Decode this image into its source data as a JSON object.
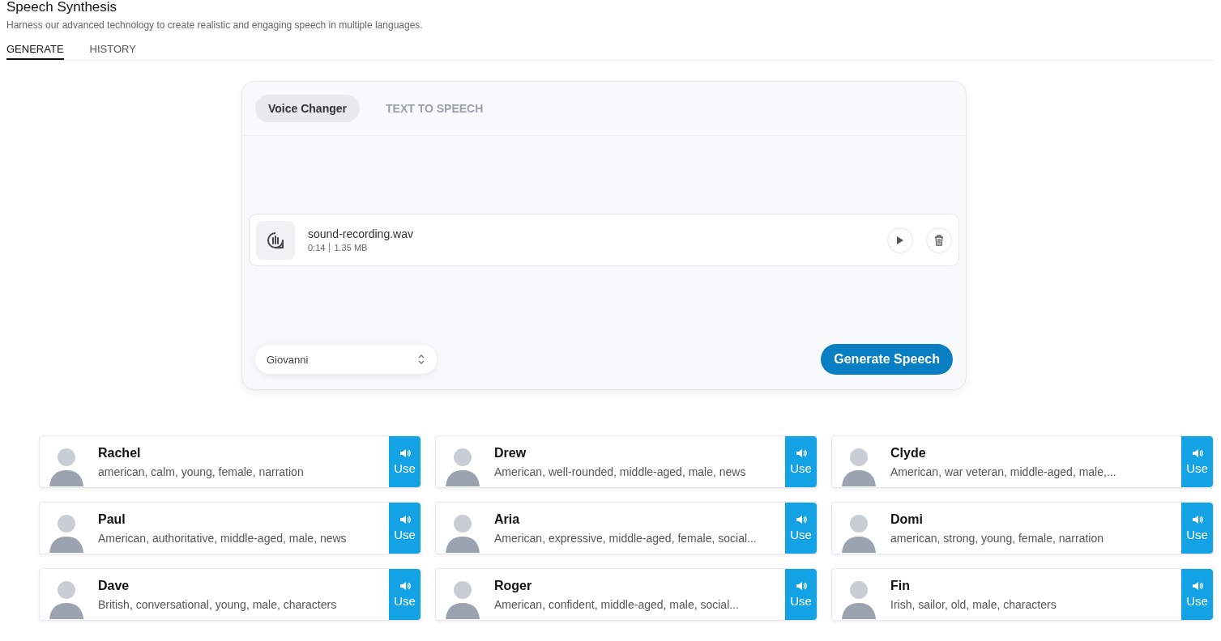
{
  "header": {
    "title": "Speech Synthesis",
    "subtitle": "Harness our advanced technology to create realistic and engaging speech in multiple languages."
  },
  "tabs": [
    {
      "label": "GENERATE",
      "selected": true
    },
    {
      "label": "HISTORY",
      "selected": false
    }
  ],
  "panel": {
    "tabs": [
      {
        "label": "Voice Changer",
        "selected": true
      },
      {
        "label": "TEXT TO SPEECH",
        "selected": false
      }
    ],
    "file": {
      "name": "sound-recording.wav",
      "duration": "0:14",
      "size": "1.35 MB"
    },
    "voice_select": {
      "value": "Giovanni"
    },
    "generate_button": "Generate Speech"
  },
  "voices": [
    {
      "name": "Rachel",
      "description": "american, calm, young, female, narration",
      "button": "Use"
    },
    {
      "name": "Drew",
      "description": "American, well-rounded, middle-aged, male, news",
      "button": "Use"
    },
    {
      "name": "Clyde",
      "description": "American, war veteran, middle-aged, male,...",
      "button": "Use"
    },
    {
      "name": "Paul",
      "description": "American, authoritative, middle-aged, male, news",
      "button": "Use"
    },
    {
      "name": "Aria",
      "description": "American, expressive, middle-aged, female, social...",
      "button": "Use"
    },
    {
      "name": "Domi",
      "description": "american, strong, young, female, narration",
      "button": "Use"
    },
    {
      "name": "Dave",
      "description": "British, conversational, young, male, characters",
      "button": "Use"
    },
    {
      "name": "Roger",
      "description": "American, confident, middle-aged, male, social...",
      "button": "Use"
    },
    {
      "name": "Fin",
      "description": "Irish, sailor, old, male, characters",
      "button": "Use"
    }
  ]
}
